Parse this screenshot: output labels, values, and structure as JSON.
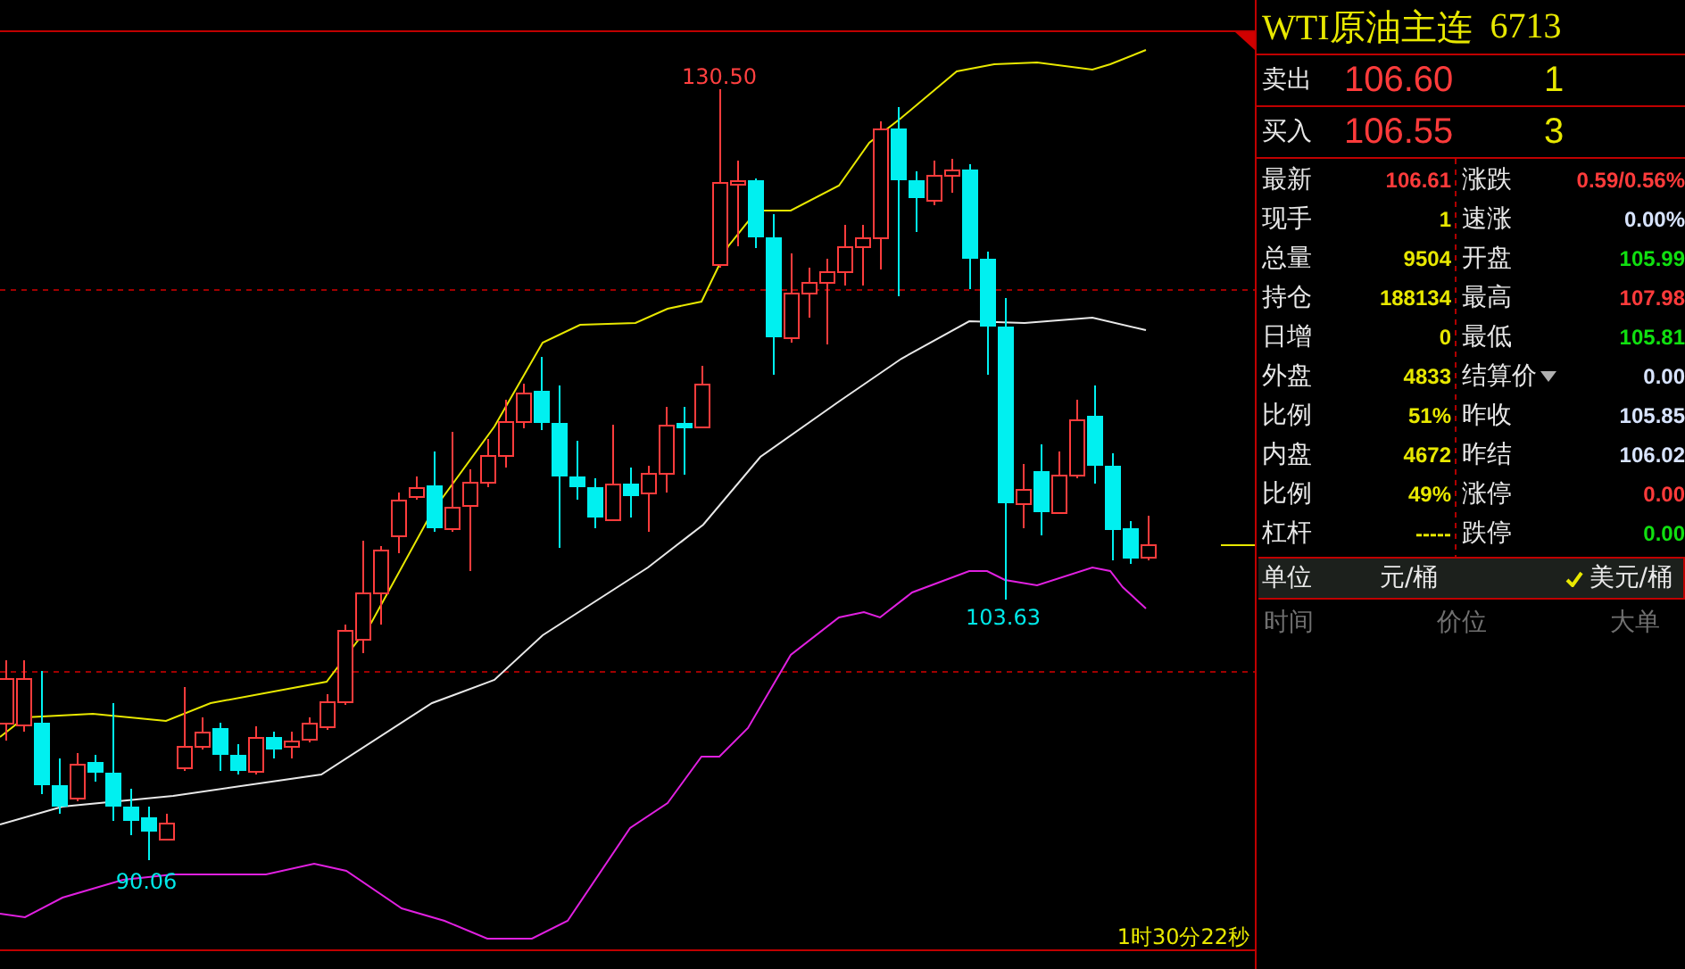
{
  "chart": {
    "high_label": "130.50",
    "low_label": "90.06",
    "recent_low_label": "103.63",
    "countdown": "1时30分22秒"
  },
  "instrument": {
    "title": "WTI原油主连",
    "code": "6713"
  },
  "quotes": [
    {
      "label": "卖出",
      "price": "106.60",
      "volume": "1"
    },
    {
      "label": "买入",
      "price": "106.55",
      "volume": "3"
    }
  ],
  "stats": [
    {
      "left": {
        "label": "最新",
        "value": "106.61",
        "color": "#ff3b3b"
      },
      "right": {
        "label": "涨跌",
        "value": "0.59/0.56%",
        "color": "#ff3b3b",
        "dropdown": false
      }
    },
    {
      "left": {
        "label": "现手",
        "value": "1",
        "color": "#e8e800"
      },
      "right": {
        "label": "速涨",
        "value": "0.00%",
        "color": "#d8e4ff",
        "dropdown": false
      }
    },
    {
      "left": {
        "label": "总量",
        "value": "9504",
        "color": "#e8e800"
      },
      "right": {
        "label": "开盘",
        "value": "105.99",
        "color": "#10e010",
        "dropdown": false
      }
    },
    {
      "left": {
        "label": "持仓",
        "value": "188134",
        "color": "#e8e800"
      },
      "right": {
        "label": "最高",
        "value": "107.98",
        "color": "#ff3b3b",
        "dropdown": false
      }
    },
    {
      "left": {
        "label": "日增",
        "value": "0",
        "color": "#e8e800"
      },
      "right": {
        "label": "最低",
        "value": "105.81",
        "color": "#10e010",
        "dropdown": false
      }
    },
    {
      "left": {
        "label": "外盘",
        "value": "4833",
        "color": "#e8e800"
      },
      "right": {
        "label": "结算价",
        "value": "0.00",
        "color": "#d8e4ff",
        "dropdown": true
      }
    },
    {
      "left": {
        "label": "比例",
        "value": "51%",
        "color": "#e8e800"
      },
      "right": {
        "label": "昨收",
        "value": "105.85",
        "color": "#d8e4ff",
        "dropdown": false
      }
    },
    {
      "left": {
        "label": "内盘",
        "value": "4672",
        "color": "#e8e800"
      },
      "right": {
        "label": "昨结",
        "value": "106.02",
        "color": "#d8e4ff",
        "dropdown": false
      }
    },
    {
      "left": {
        "label": "比例",
        "value": "49%",
        "color": "#e8e800"
      },
      "right": {
        "label": "涨停",
        "value": "0.00",
        "color": "#ff3b3b",
        "dropdown": false
      }
    },
    {
      "left": {
        "label": "杠杆",
        "value": "-----",
        "color": "#e8e800"
      },
      "right": {
        "label": "跌停",
        "value": "0.00",
        "color": "#10e010",
        "dropdown": false
      }
    }
  ],
  "unit": {
    "label": "单位",
    "options": [
      {
        "label": "元/桶",
        "selected": false
      },
      {
        "label": "美元/桶",
        "selected": true
      }
    ]
  },
  "ticks_table": {
    "columns": [
      "时间",
      "价位",
      "大单"
    ]
  }
}
